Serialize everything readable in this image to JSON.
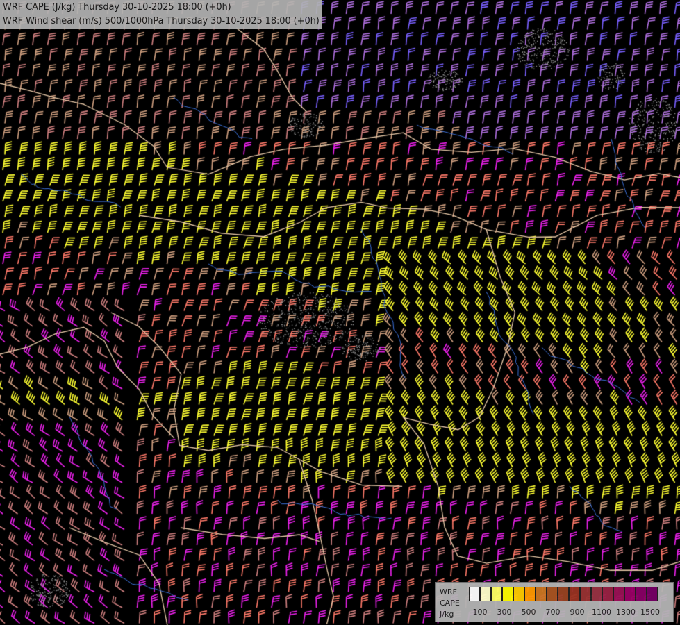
{
  "titles": {
    "line1": "WRF CAPE (J/kg) Thursday 30-10-2025 18:00 (+0h)",
    "line2": "WRF Wind shear (m/s) 500/1000hPa Thursday 30-10-2025 18:00 (+0h)"
  },
  "legend": {
    "label_line1": "WRF",
    "label_line2": "CAPE",
    "label_line3": "J/kg",
    "ticks": [
      "100",
      "300",
      "500",
      "700",
      "900",
      "1100",
      "1300",
      "1500"
    ],
    "colors": [
      "#ffffff",
      "#ffffcc",
      "#ffff66",
      "#ffff00",
      "#ffcc00",
      "#ff9900",
      "#cc7722",
      "#aa5522",
      "#994422",
      "#993322",
      "#993333",
      "#993344",
      "#992244",
      "#991155",
      "#990066",
      "#880066",
      "#770066"
    ]
  },
  "map_colors": {
    "yellow": "#ffff33",
    "salmon": "#ff7a6a",
    "dusty_pink": "#d08080",
    "tan": "#d0a080",
    "magenta": "#ee22ee",
    "violet": "#b070e0",
    "blue_violet": "#7a60ff",
    "coast": "#3b6fd8",
    "border": "#e8c9a8"
  }
}
